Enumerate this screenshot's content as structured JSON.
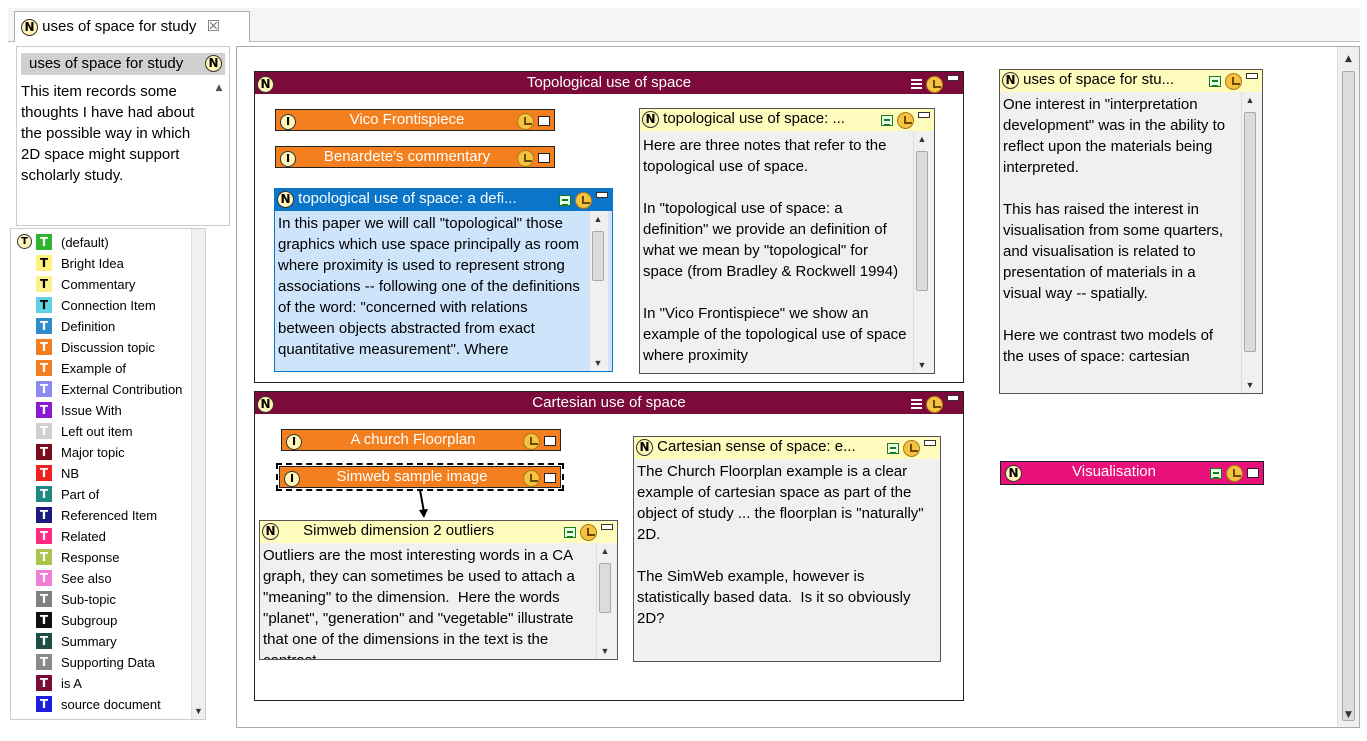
{
  "tab": {
    "title": "uses of space for study",
    "close": "☒"
  },
  "left_note": {
    "title": "uses of space for study",
    "text": "This item records some thoughts I have had about the possible way in which 2D space might support scholarly study."
  },
  "prototypes": [
    {
      "name": "(default)",
      "color": "#2db52d"
    },
    {
      "name": "Bright Idea",
      "color": "#fff27a",
      "dark": true
    },
    {
      "name": "Commentary",
      "color": "#fbf38a",
      "dark": true
    },
    {
      "name": "Connection Item",
      "color": "#5fd2e6",
      "dark": true
    },
    {
      "name": "Definition",
      "color": "#2f8ccc"
    },
    {
      "name": "Discussion topic",
      "color": "#f37e20"
    },
    {
      "name": "Example of",
      "color": "#f37e20"
    },
    {
      "name": "External Contribution",
      "color": "#8c8cf0"
    },
    {
      "name": "Issue With",
      "color": "#8a1ad6"
    },
    {
      "name": "Left out item",
      "color": "#d0d0d0"
    },
    {
      "name": "Major topic",
      "color": "#7a0c1c"
    },
    {
      "name": "NB",
      "color": "#ee2020"
    },
    {
      "name": "Part of",
      "color": "#1f8a80"
    },
    {
      "name": "Referenced Item",
      "color": "#1a1a80"
    },
    {
      "name": "Related",
      "color": "#ff2a7f"
    },
    {
      "name": "Response",
      "color": "#a9c64a"
    },
    {
      "name": "See also",
      "color": "#f07ed8"
    },
    {
      "name": "Sub-topic",
      "color": "#808080"
    },
    {
      "name": "Subgroup",
      "color": "#111111"
    },
    {
      "name": "Summary",
      "color": "#1c4e44"
    },
    {
      "name": "Supporting Data",
      "color": "#8a8a8a"
    },
    {
      "name": "is A",
      "color": "#7a0c3a"
    },
    {
      "name": "source document",
      "color": "#1e1ee0"
    }
  ],
  "topological": {
    "title": "Topological use of space",
    "bars": [
      "Vico Frontispiece",
      "Benardete's commentary"
    ],
    "def_note": {
      "title": "topological use of space: a defi...",
      "text": "In this paper we will call \"topological\" those graphics which use space principally as room where proximity is used to represent strong associations -- following one of the definitions of the word: \"concerned with relations between objects abstracted from exact quantitative measurement\". Where"
    },
    "side_note": {
      "title": "topological use of space: ...",
      "text": "Here are three notes that refer to the topological use of space.\n\nIn \"topological use of space: a definition\" we provide an definition of what we mean by \"topological\" for space (from Bradley & Rockwell 1994)\n\nIn \"Vico Frontispiece\" we show an example of the topological use of space where proximity"
    }
  },
  "cartesian": {
    "title": "Cartesian use of space",
    "bars": [
      "A church Floorplan",
      "Simweb sample image"
    ],
    "outliers": {
      "title": "Simweb dimension 2 outliers",
      "text": "Outliers are the most interesting words in a CA graph, they can sometimes be used to attach a \"meaning\" to the dimension.  Here the words \"planet\", \"generation\" and \"vegetable\" illustrate that one of the dimensions in the text is the contrast"
    },
    "sense": {
      "title": "Cartesian sense of space: e...",
      "text": "The Church Floorplan example is a clear example of cartesian space as part of the object of study ... the floorplan is \"naturally\" 2D.\n\nThe SimWeb example, however is statistically based data.  Is it so obviously 2D?"
    }
  },
  "uses_note": {
    "title": "uses of space for stu...",
    "text": "One interest in \"interpretation development\" was in the ability to reflect upon the materials being interpreted.\n\nThis has raised the interest in visualisation from some quarters, and visualisation is related to presentation of materials in a visual way -- spatially.\n\nHere we contrast two models of the uses of space: cartesian"
  },
  "visualisation": {
    "title": "Visualisation"
  },
  "colors": {
    "container": "#7c0a3a",
    "orange": "#f47f1e",
    "blue": "#0b75c9",
    "note_yellow": "#fffbbd",
    "magenta": "#e8117a"
  }
}
